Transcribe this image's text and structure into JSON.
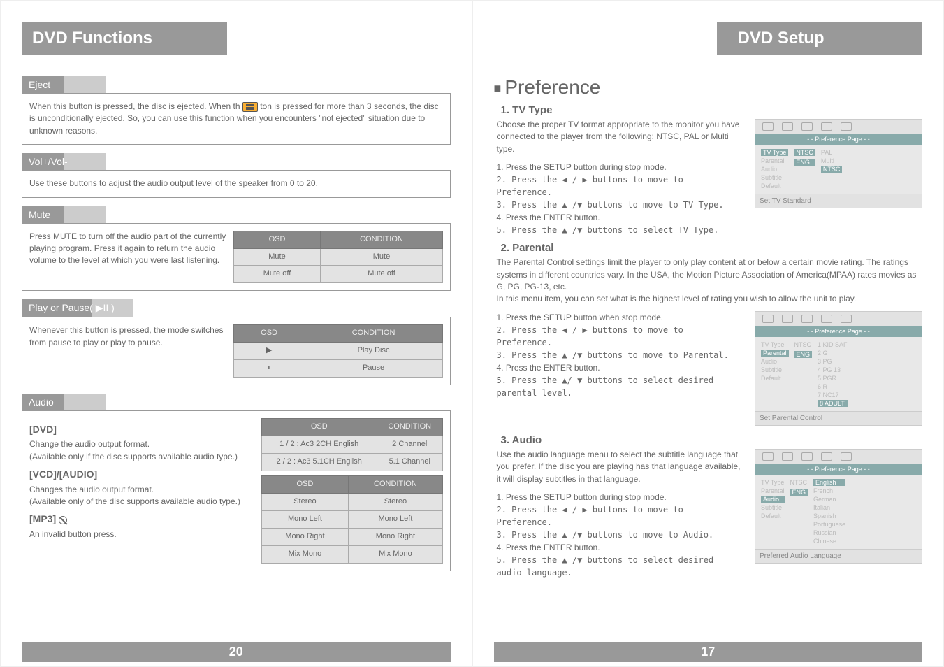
{
  "left": {
    "header": "DVD Functions",
    "page_num": "20",
    "eject": {
      "title": "Eject",
      "body_a": "When this button is pressed, the disc is ejected. When th",
      "body_b": "ton is pressed for more than 3 seconds, the disc is unconditionally ejected. So, you can use this function when you encounters  \"not ejected\"  situation due to unknown reasons."
    },
    "vol": {
      "title": "Vol+/Vol-",
      "body": "Use these buttons to adjust the audio output level of the speaker from 0 to 20."
    },
    "mute": {
      "title": "Mute",
      "body": "Press MUTE to turn off the audio part of the currently playing program. Press it again to return the audio volume to the level at which you were last listening.",
      "table": {
        "h1": "OSD",
        "h2": "CONDITION",
        "r": [
          [
            "Mute",
            "Mute"
          ],
          [
            "Mute off",
            "Mute off"
          ]
        ]
      }
    },
    "play": {
      "title": "Play or Pause( ▶II )",
      "body": "Whenever this button is pressed, the mode switches from pause to play or play to pause.",
      "table": {
        "h1": "OSD",
        "h2": "CONDITION",
        "r": [
          [
            "▶",
            "Play Disc"
          ],
          [
            "⏸",
            "Pause"
          ]
        ]
      }
    },
    "audio": {
      "title": "Audio",
      "dvd_h": "[DVD]",
      "dvd_t": "Change the audio output format.\n(Available only if the disc supports available audio type.)",
      "vcd_h": "[VCD]/[AUDIO]",
      "vcd_t": "Changes the audio output format.\n(Available only of the disc supports available audio type.)",
      "mp3_h": "[MP3]",
      "mp3_t": "An invalid button press.",
      "t1": {
        "h1": "OSD",
        "h2": "CONDITION",
        "r": [
          [
            "1 / 2 : Ac3 2CH English",
            "2 Channel"
          ],
          [
            "2 / 2 : Ac3 5.1CH English",
            "5.1 Channel"
          ]
        ]
      },
      "t2": {
        "h1": "OSD",
        "h2": "CONDITION",
        "r": [
          [
            "Stereo",
            "Stereo"
          ],
          [
            "Mono Left",
            "Mono Left"
          ],
          [
            "Mono Right",
            "Mono Right"
          ],
          [
            "Mix Mono",
            "Mix Mono"
          ]
        ]
      }
    }
  },
  "right": {
    "header": "DVD Setup",
    "page_num": "17",
    "pref_title": "Preference",
    "tv": {
      "h": "1. TV Type",
      "p": "Choose the proper TV format appropriate to the monitor you have connected to the player from the following: NTSC, PAL or Multi type.",
      "steps": [
        "1. Press the SETUP button during stop mode.",
        "2. Press the ◀ / ▶ buttons to move to Preference.",
        "3. Press the ▲ /▼  buttons to move to TV Type.",
        "4. Press the ENTER button.",
        "5. Press the ▲ /▼  buttons to select TV Type."
      ],
      "osd": {
        "bar": "- - Preference Page - -",
        "left": [
          "TV Type",
          "Parental",
          "Audio",
          "Subtitle",
          "Default"
        ],
        "mid": [
          "NTSC",
          "",
          "ENG"
        ],
        "right": [
          "PAL",
          "Multi",
          "NTSC"
        ],
        "sub": "Set TV Standard"
      }
    },
    "parental": {
      "h": "2. Parental",
      "p": "The Parental Control settings limit the player to only play content at or below a certain movie rating. The ratings systems in different countries vary. In the USA, the Motion Picture Association of America(MPAA) rates movies as G, PG, PG-13, etc.\nIn this menu item, you can set what is the highest level of rating you wish to allow the unit to play.",
      "steps": [
        "1. Press the SETUP button when stop mode.",
        "2. Press the ◀ / ▶ buttons to move to Preference.",
        "3. Press the ▲ /▼  buttons to move to Parental.",
        "4. Press the ENTER button.",
        "5. Press the  ▲/ ▼  buttons to select desired parental level."
      ],
      "osd": {
        "bar": "- - Preference Page - -",
        "left": [
          "TV Type",
          "Parental",
          "Audio",
          "Subtitle",
          "Default"
        ],
        "mid": [
          "NTSC",
          "",
          "ENG"
        ],
        "right": [
          "1 KID SAF",
          "2 G",
          "3 PG",
          "4 PG 13",
          "5 PGR",
          "6 R",
          "7 NC17",
          "8 ADULT"
        ],
        "sub": "Set Parental Control"
      }
    },
    "audio": {
      "h": "3. Audio",
      "p": "Use the audio language menu to select the subtitle language that you prefer. If the disc you are playing has that language available, it will display subtitles in that language.",
      "steps": [
        "1. Press the SETUP button during stop mode.",
        "2. Press the ◀ / ▶ buttons to move to Preference.",
        "3. Press the ▲ /▼  buttons to move to Audio.",
        "4. Press the ENTER button.",
        "5. Press the ▲ /▼  buttons to select desired audio language."
      ],
      "osd": {
        "bar": "- - Preference Page - -",
        "left": [
          "TV Type",
          "Parental",
          "Audio",
          "Subtitle",
          "Default"
        ],
        "mid": [
          "NTSC",
          "",
          "ENG"
        ],
        "right": [
          "English",
          "French",
          "German",
          "Italian",
          "Spanish",
          "Portuguese",
          "Russian",
          "Chinese"
        ],
        "sub": "Preferred Audio Language"
      }
    }
  }
}
